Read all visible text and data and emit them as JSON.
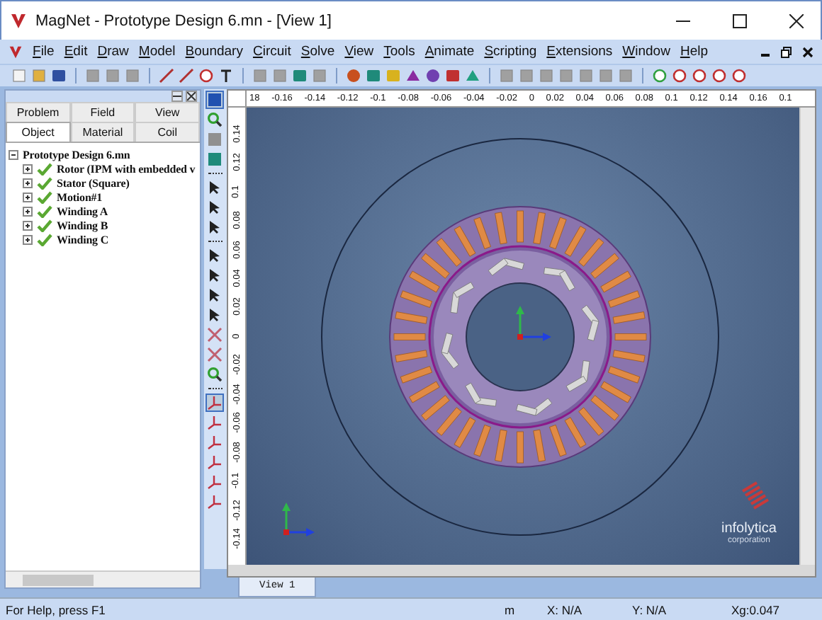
{
  "window": {
    "title": "MagNet - Prototype Design 6.mn - [View 1]"
  },
  "menu": [
    "File",
    "Edit",
    "Draw",
    "Model",
    "Boundary",
    "Circuit",
    "Solve",
    "View",
    "Tools",
    "Animate",
    "Scripting",
    "Extensions",
    "Window",
    "Help"
  ],
  "panel": {
    "tabs_row_1": [
      {
        "label": "Problem",
        "selected": false
      },
      {
        "label": "Field",
        "selected": false
      },
      {
        "label": "View",
        "selected": false
      }
    ],
    "tabs_row_2": [
      {
        "label": "Object",
        "selected": true
      },
      {
        "label": "Material",
        "selected": false
      },
      {
        "label": "Coil",
        "selected": false
      }
    ],
    "tree": [
      {
        "label": "Prototype Design 6.mn",
        "expanded": true,
        "children": [
          {
            "label": "Rotor (IPM with embedded v",
            "expanded": false,
            "valid": true
          },
          {
            "label": "Stator (Square)",
            "expanded": false,
            "valid": true
          },
          {
            "label": "Motion#1",
            "expanded": false,
            "valid": true
          },
          {
            "label": "Winding A",
            "expanded": false,
            "valid": true
          },
          {
            "label": "Winding B",
            "expanded": false,
            "valid": true
          },
          {
            "label": "Winding C",
            "expanded": false,
            "valid": true
          }
        ]
      }
    ]
  },
  "view": {
    "x_ruler": [
      "18",
      "-0.16",
      "-0.14",
      "-0.12",
      "-0.1",
      "-0.08",
      "-0.06",
      "-0.04",
      "-0.02",
      "0",
      "0.02",
      "0.04",
      "0.06",
      "0.08",
      "0.1",
      "0.12",
      "0.14",
      "0.16",
      "0.1"
    ],
    "y_ruler": [
      "0.14",
      "0.12",
      "0.1",
      "0.08",
      "0.06",
      "0.04",
      "0.02",
      "0",
      "-0.02",
      "-0.04",
      "-0.06",
      "-0.08",
      "-0.1",
      "-0.12",
      "-0.14"
    ],
    "logo": {
      "name": "infolytica",
      "subtitle": "corporation"
    },
    "tabs": [
      {
        "label": "View 1",
        "selected": true
      }
    ]
  },
  "status_bar": [
    "For Help, press F1",
    "m",
    "X: N/A",
    "Y: N/A",
    "Xg:0.047"
  ]
}
